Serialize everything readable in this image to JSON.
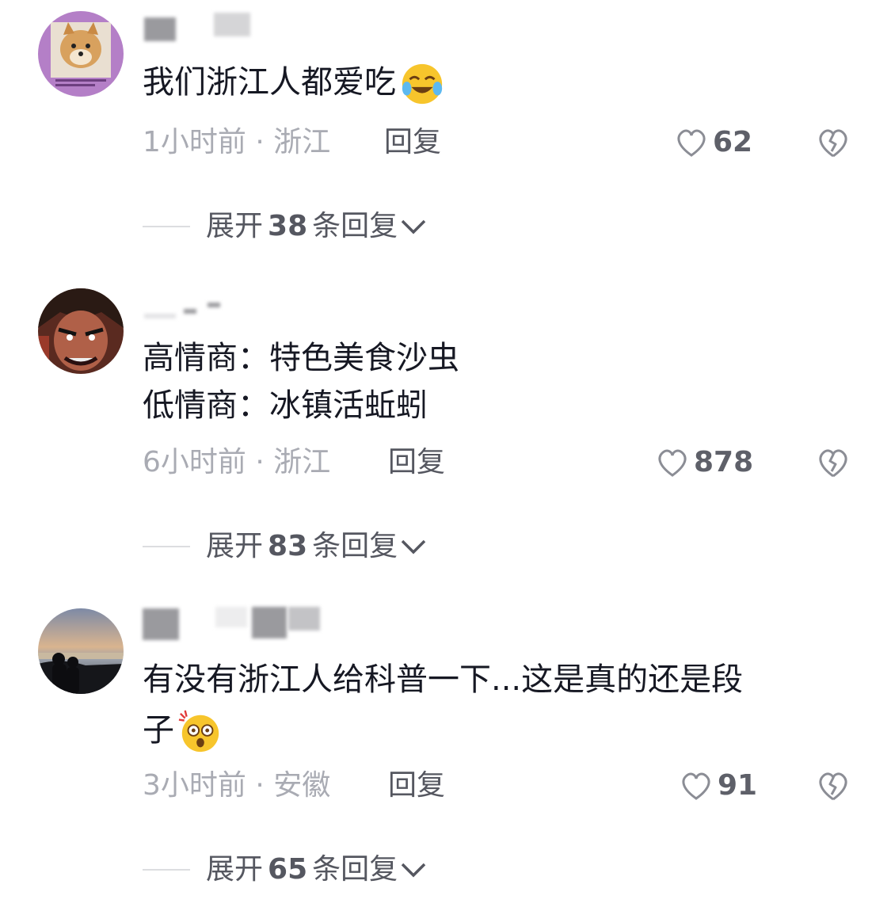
{
  "comments": [
    {
      "text": "我们浙江人都爱吃",
      "time": "1小时前",
      "sep": " · ",
      "location": "浙江",
      "reply": "回复",
      "likes": "62",
      "expand_prefix": "展开",
      "expand_count": "38",
      "expand_suffix": "条回复",
      "emoji": "laughing-tears-emoji"
    },
    {
      "text": "高情商：特色美食沙虫\n低情商：冰镇活蚯蚓",
      "time": "6小时前",
      "sep": " · ",
      "location": "浙江",
      "reply": "回复",
      "likes": "878",
      "expand_prefix": "展开",
      "expand_count": "83",
      "expand_suffix": "条回复"
    },
    {
      "text": "有没有浙江人给科普一下...这是真的还是段\n子",
      "time": "3小时前",
      "sep": " · ",
      "location": "安徽",
      "reply": "回复",
      "likes": "91",
      "expand_prefix": "展开",
      "expand_count": "65",
      "expand_suffix": "条回复",
      "emoji": "shocked-emoji"
    }
  ],
  "colors": {
    "text": "#161823",
    "meta": "#a9abb3",
    "accent_gray": "#555760"
  }
}
